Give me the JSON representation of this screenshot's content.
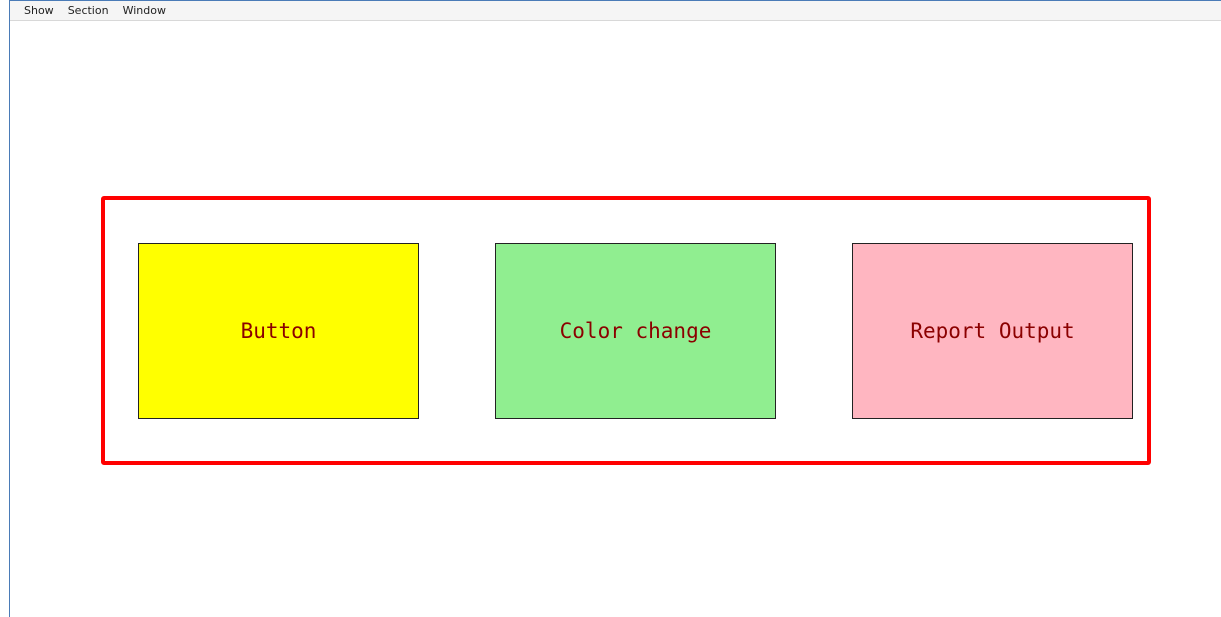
{
  "menu": {
    "items": [
      {
        "label": "Show"
      },
      {
        "label": "Section"
      },
      {
        "label": "Window"
      }
    ]
  },
  "buttons": [
    {
      "label": "Button",
      "bg_color": "#ffff00"
    },
    {
      "label": "Color change",
      "bg_color": "#90ee90"
    },
    {
      "label": "Report Output",
      "bg_color": "#ffb6c1"
    }
  ],
  "colors": {
    "highlight_frame": "#ff0000",
    "button_text": "#8b0000"
  }
}
